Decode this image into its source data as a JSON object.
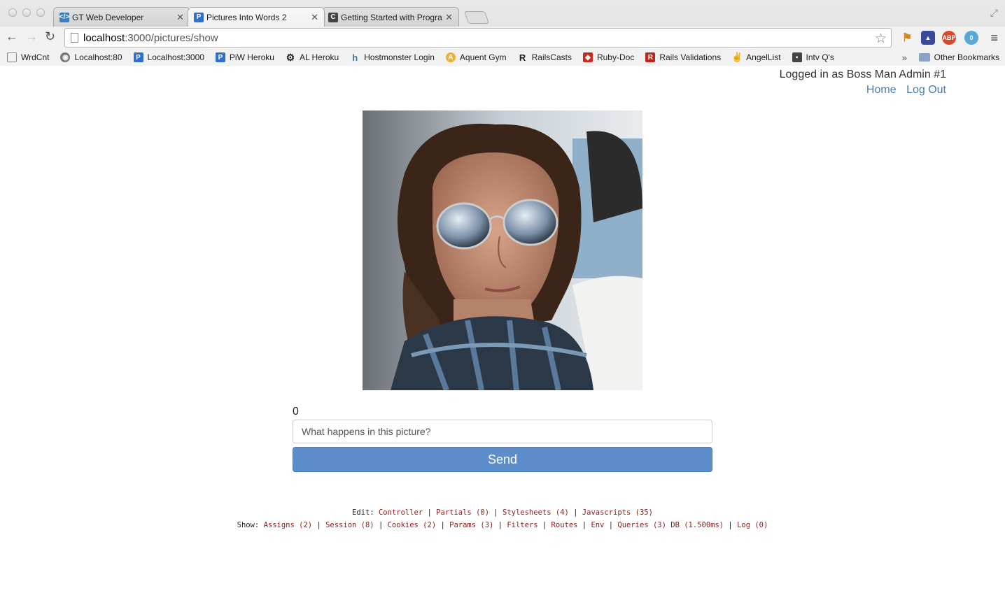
{
  "tabs": [
    {
      "title": "GT Web Developer",
      "icon": "code-icon",
      "color": "#3a7fc0",
      "active": false
    },
    {
      "title": "Pictures Into Words 2",
      "icon": "p-logo-icon",
      "color": "#2f6fd0",
      "active": true
    },
    {
      "title": "Getting Started with Progra",
      "icon": "c-logo-icon",
      "color": "#444444",
      "active": false
    }
  ],
  "address": {
    "host": "localhost",
    "path": ":3000/pictures/show"
  },
  "bookmarks": [
    {
      "label": "WrdCnt",
      "icon": "page-icon",
      "color": "#ffffff"
    },
    {
      "label": "Localhost:80",
      "icon": "globe-icon",
      "color": "#777777"
    },
    {
      "label": "Localhost:3000",
      "icon": "p-logo-icon",
      "color": "#2f6fd0"
    },
    {
      "label": "PiW Heroku",
      "icon": "p-logo-icon",
      "color": "#2f6fd0"
    },
    {
      "label": "AL Heroku",
      "icon": "gear-icon",
      "color": "#222222"
    },
    {
      "label": "Hostmonster Login",
      "icon": "h-logo-icon",
      "color": "#3a7a9a"
    },
    {
      "label": "Aquent Gym",
      "icon": "a-logo-icon",
      "color": "#f0b030"
    },
    {
      "label": "RailsCasts",
      "icon": "r-logo-icon",
      "color": "#222222"
    },
    {
      "label": "Ruby-Doc",
      "icon": "ruby-icon",
      "color": "#cc2a20"
    },
    {
      "label": "Rails Validations",
      "icon": "rails-icon",
      "color": "#c0261c"
    },
    {
      "label": "AngelList",
      "icon": "peace-icon",
      "color": "#333333"
    },
    {
      "label": "Intv Q's",
      "icon": "image-icon",
      "color": "#444444"
    }
  ],
  "bookmarks_more": "»",
  "other_bookmarks": "Other Bookmarks",
  "user": {
    "logged_in": "Logged in as Boss Man Admin #1",
    "home": "Home",
    "logout": "Log Out"
  },
  "form": {
    "counter": "0",
    "placeholder": "What happens in this picture?",
    "send": "Send"
  },
  "debug": {
    "edit_label": "Edit:",
    "edit_links": [
      "Controller",
      "Partials (0)",
      "Stylesheets (4)",
      "Javascripts (35)"
    ],
    "show_label": "Show:",
    "show_links": [
      "Assigns (2)",
      "Session (8)",
      "Cookies (2)",
      "Params (3)",
      "Filters",
      "Routes",
      "Env",
      "Queries (3) DB (1.500ms)",
      "Log (0)"
    ]
  }
}
